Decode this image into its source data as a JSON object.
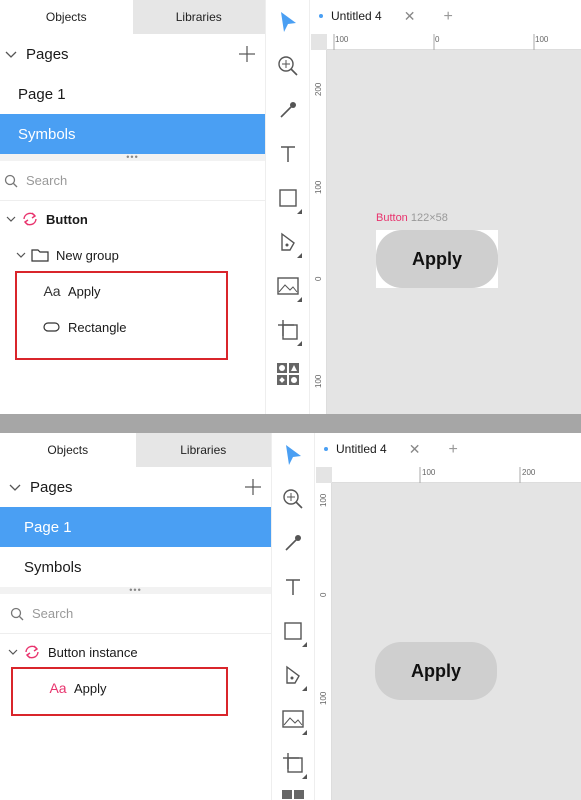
{
  "panels": [
    {
      "left_tabs": [
        "Objects",
        "Libraries"
      ],
      "pages_title": "Pages",
      "pages": [
        {
          "label": "Page 1",
          "selected": false
        },
        {
          "label": "Symbols",
          "selected": true
        }
      ],
      "search_placeholder": "Search",
      "tree": [
        {
          "label": "Button",
          "bold": true,
          "icon": "symbol-icon"
        },
        {
          "label": "New group",
          "icon": "folder-icon"
        },
        {
          "label": "Apply",
          "icon": "text-layer-icon"
        },
        {
          "label": "Rectangle",
          "icon": "rectangle-layer-icon"
        }
      ],
      "doc_tab": "Untitled 4",
      "ruler_h": [
        "100",
        "0",
        "100"
      ],
      "ruler_v": [
        "200",
        "100",
        "0",
        "100"
      ],
      "selection_name": "Button",
      "selection_size": "122×58",
      "button_text": "Apply"
    },
    {
      "left_tabs": [
        "Objects",
        "Libraries"
      ],
      "pages_title": "Pages",
      "pages": [
        {
          "label": "Page 1",
          "selected": true
        },
        {
          "label": "Symbols",
          "selected": false
        }
      ],
      "search_placeholder": "Search",
      "tree": [
        {
          "label": "Button instance",
          "bold": false,
          "icon": "symbol-instance-icon"
        },
        {
          "label": "Apply",
          "icon": "text-layer-icon"
        }
      ],
      "doc_tab": "Untitled 4",
      "ruler_h": [
        "100",
        "200"
      ],
      "ruler_v": [
        "100",
        "0",
        "100"
      ],
      "button_text": "Apply"
    }
  ],
  "colors": {
    "accent": "#4a9ff3",
    "symbol": "#e8336d",
    "highlight": "#d9252b"
  }
}
